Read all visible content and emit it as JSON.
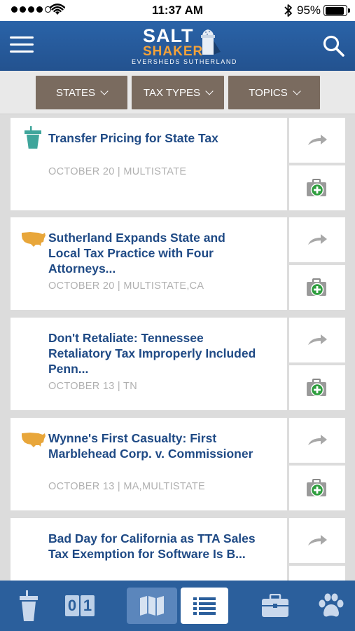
{
  "status_bar": {
    "time": "11:37 AM",
    "battery": "95%",
    "battery_level": 0.95
  },
  "header": {
    "logo_line1": "SALT",
    "logo_line2": "SHAKER",
    "logo_line3": "EVERSHEDS SUTHERLAND",
    "menu_icon": "hamburger-menu-icon",
    "search_icon": "search-icon"
  },
  "filters": [
    {
      "label": "STATES"
    },
    {
      "label": "TAX TYPES"
    },
    {
      "label": "TOPICS"
    }
  ],
  "articles": [
    {
      "title": "Transfer Pricing for State Tax",
      "meta": "OCTOBER 20 | MULTISTATE",
      "icon": "podium-icon"
    },
    {
      "title": "Sutherland Expands State and Local Tax Practice with Four Attorneys...",
      "meta": "OCTOBER 20 | MULTISTATE,CA",
      "icon": "us-map-icon"
    },
    {
      "title": "Don't Retaliate: Tennessee Retaliatory Tax Improperly Included Penn...",
      "meta": "OCTOBER 13 | TN",
      "icon": ""
    },
    {
      "title": "Wynne's First Casualty: First Marblehead Corp. v. Commissioner",
      "meta": "OCTOBER 13 | MA,MULTISTATE",
      "icon": "us-map-icon"
    },
    {
      "title": "Bad Day for California as TTA Sales Tax Exemption for Software Is B...",
      "meta": "",
      "icon": ""
    }
  ],
  "tabs": {
    "counter_digits": [
      "0",
      "1"
    ],
    "items": [
      "podium-icon",
      "counter-icon",
      "map-icon",
      "list-icon",
      "briefcase-icon",
      "paw-icon"
    ],
    "active": "list"
  },
  "colors": {
    "header_blue": "#2a63a8",
    "filter_brown": "#7a6b5f",
    "title_blue": "#1f4a85",
    "logo_orange": "#f4a23a",
    "map_gold": "#e8a63a",
    "podium_teal": "#3fa59b",
    "save_green": "#2e9e3e"
  }
}
